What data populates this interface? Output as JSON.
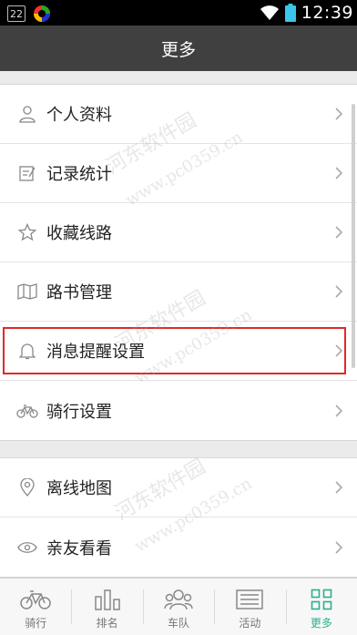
{
  "status_bar": {
    "badge": "22",
    "time": "12:39"
  },
  "header": {
    "title": "更多"
  },
  "groups": [
    {
      "items": [
        {
          "label": "个人资料",
          "icon": "person-icon"
        },
        {
          "label": "记录统计",
          "icon": "edit-note-icon"
        },
        {
          "label": "收藏线路",
          "icon": "star-icon"
        },
        {
          "label": "路书管理",
          "icon": "map-book-icon"
        },
        {
          "label": "消息提醒设置",
          "icon": "bell-icon",
          "highlighted": true
        },
        {
          "label": "骑行设置",
          "icon": "bicycle-icon"
        }
      ]
    },
    {
      "items": [
        {
          "label": "离线地图",
          "icon": "location-pin-icon"
        },
        {
          "label": "亲友看看",
          "icon": "eye-icon"
        }
      ]
    }
  ],
  "bottom_nav": {
    "items": [
      {
        "label": "骑行",
        "icon": "bicycle-icon"
      },
      {
        "label": "排名",
        "icon": "bar-chart-icon"
      },
      {
        "label": "车队",
        "icon": "team-icon"
      },
      {
        "label": "活动",
        "icon": "list-icon"
      },
      {
        "label": "更多",
        "icon": "grid-icon",
        "active": true
      }
    ]
  },
  "colors": {
    "title_bar": "#404040",
    "accent": "#2ab08e",
    "highlight_border": "#e0282b"
  },
  "watermark": {
    "text_cn": "河东软件园",
    "text_url": "www.pc0359.cn"
  }
}
